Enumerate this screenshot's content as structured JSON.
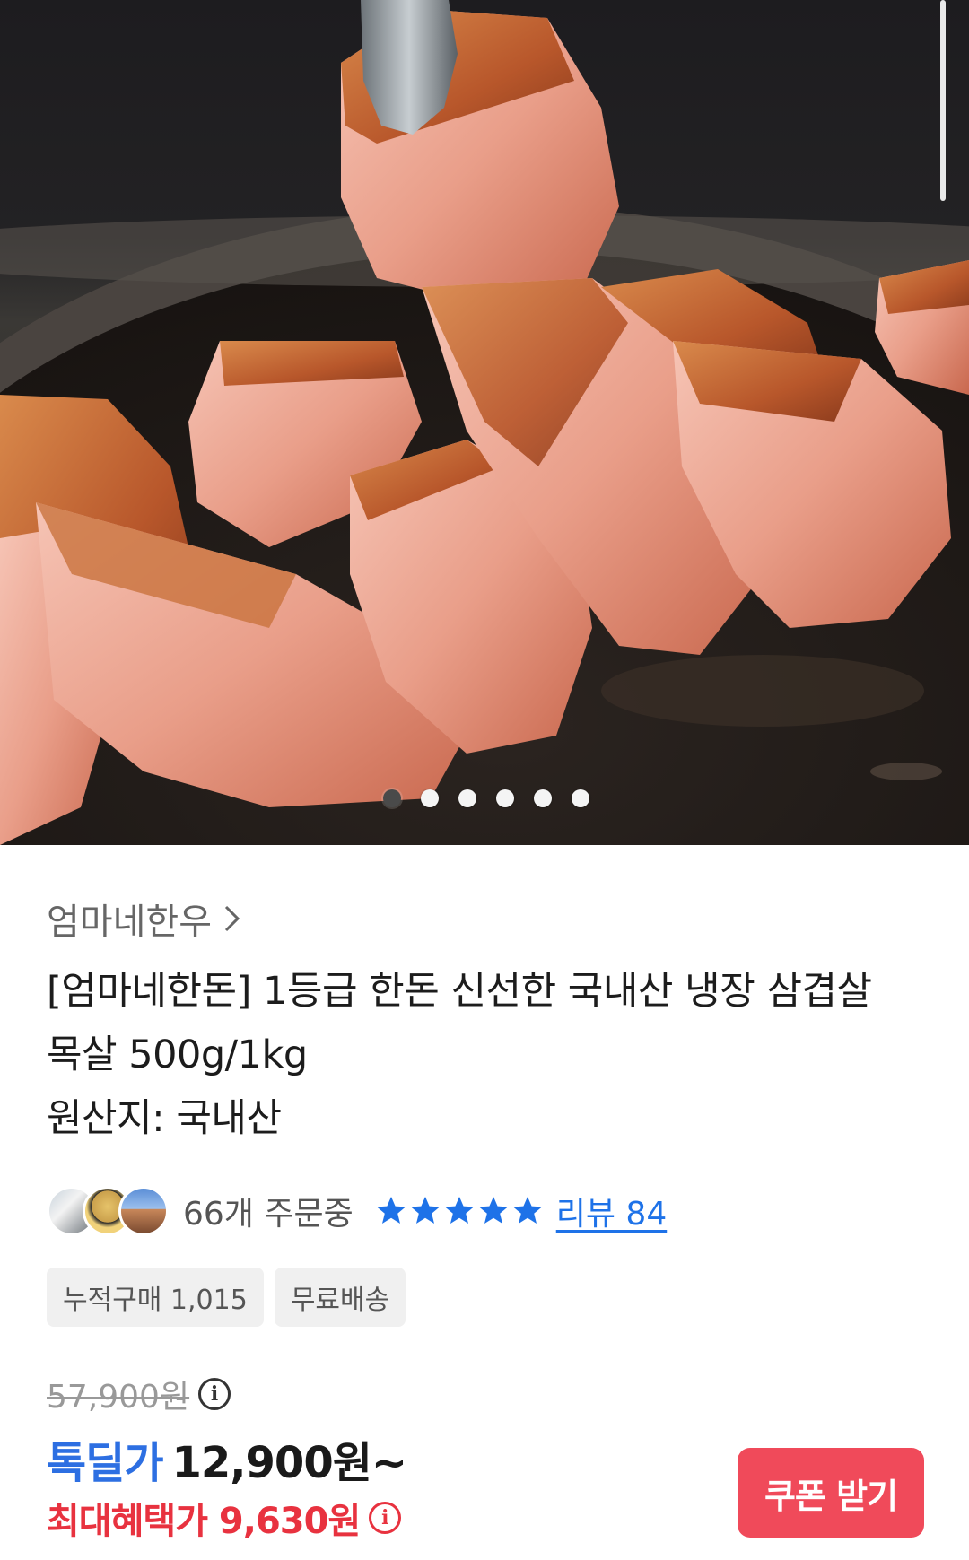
{
  "hero": {
    "carousel_total": 6,
    "carousel_active_index": 1
  },
  "seller": {
    "name": "엄마네한우"
  },
  "product": {
    "title_lines": [
      "[엄마네한돈] 1등급 한돈 신선한 국내산 냉장 삼겹살",
      "목살 500g/1kg",
      "원산지: 국내산"
    ]
  },
  "social": {
    "order_count": "66개 주문중",
    "rating_stars": 5,
    "review_label": "리뷰 84"
  },
  "tags": [
    "누적구매 1,015",
    "무료배송"
  ],
  "pricing": {
    "original_price": "57,900원",
    "deal_label": "톡딜가",
    "deal_price": "12,900원~",
    "max_benefit": "최대혜택가 9,630원",
    "coupon_button": "쿠폰 받기"
  },
  "colors": {
    "deal_blue": "#2d6fe2",
    "benefit_red": "#e8323f",
    "coupon_button_bg": "#f04a5a",
    "star_blue": "#1e72e8"
  },
  "icons": [
    "chevron-right-icon",
    "star-icon",
    "info-icon"
  ]
}
